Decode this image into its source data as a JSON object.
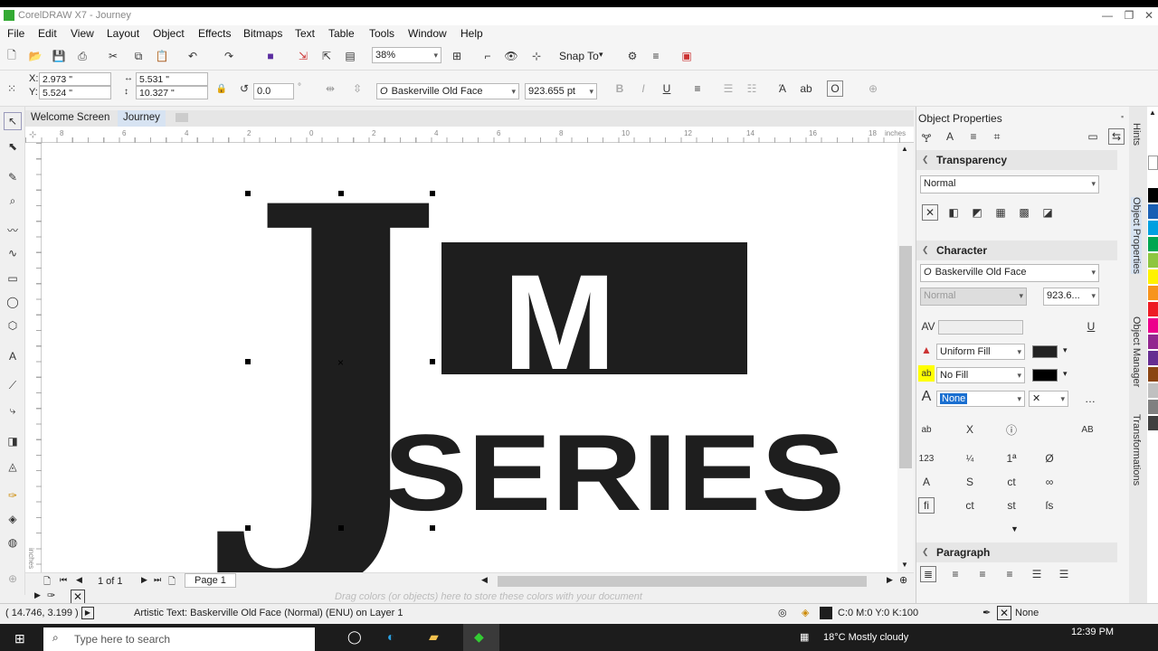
{
  "window": {
    "title": "CorelDRAW X7 - Journey"
  },
  "menu": [
    "File",
    "Edit",
    "View",
    "Layout",
    "Object",
    "Effects",
    "Bitmaps",
    "Text",
    "Table",
    "Tools",
    "Window",
    "Help"
  ],
  "standard_toolbar": {
    "zoom": "38%",
    "snap_to": "Snap To"
  },
  "property_bar": {
    "x": "2.973 \"",
    "y": "5.524 \"",
    "width": "5.531 \"",
    "height": "10.327 \"",
    "x_label": "X:",
    "y_label": "Y:",
    "angle": "0.0",
    "angle_unit": "°",
    "font": "Baskerville Old Face",
    "font_size": "923.655 pt"
  },
  "tabs": {
    "welcome": "Welcome Screen",
    "journey": "Journey"
  },
  "ruler": {
    "labels": [
      "8",
      "6",
      "4",
      "2",
      "0",
      "2",
      "4",
      "6",
      "8",
      "10",
      "12",
      "14",
      "16",
      "18"
    ],
    "units": "inches",
    "vertical_units": "inches"
  },
  "artwork": {
    "j": "J",
    "m": "M",
    "series": "SERIES"
  },
  "page_nav": {
    "count": "1 of 1",
    "page_tab": "Page 1"
  },
  "hint": "Drag colors (or objects) here to store these colors with your document",
  "status": {
    "coords": "( 14.746, 3.199 )",
    "object_info": "Artistic Text: Baskerville Old Face (Normal) (ENU) on Layer 1",
    "fill": "C:0 M:0 Y:0 K:100",
    "outline": "None"
  },
  "docker": {
    "title": "Object Properties",
    "transparency": {
      "title": "Transparency",
      "mode": "Normal"
    },
    "character": {
      "title": "Character",
      "font": "Baskerville Old Face",
      "style": "Normal",
      "size": "923.6...",
      "fill_type": "Uniform Fill",
      "bg_fill": "No Fill",
      "outline": "None"
    },
    "paragraph": {
      "title": "Paragraph"
    }
  },
  "side_tabs": [
    "Hints",
    "Object Properties",
    "Object Manager",
    "Transformations"
  ],
  "palette": [
    "#ffffff",
    "#000000",
    "#1a5fb4",
    "#00a0e0",
    "#00a651",
    "#8dc63f",
    "#fff200",
    "#f7941d",
    "#ed1c24",
    "#ec008c",
    "#92278f",
    "#662d91",
    "#8b4513",
    "#c0c0c0",
    "#808080",
    "#404040"
  ],
  "taskbar": {
    "search": "Type here to search",
    "weather": "18°C  Mostly cloudy",
    "time": "12:39 PM"
  }
}
